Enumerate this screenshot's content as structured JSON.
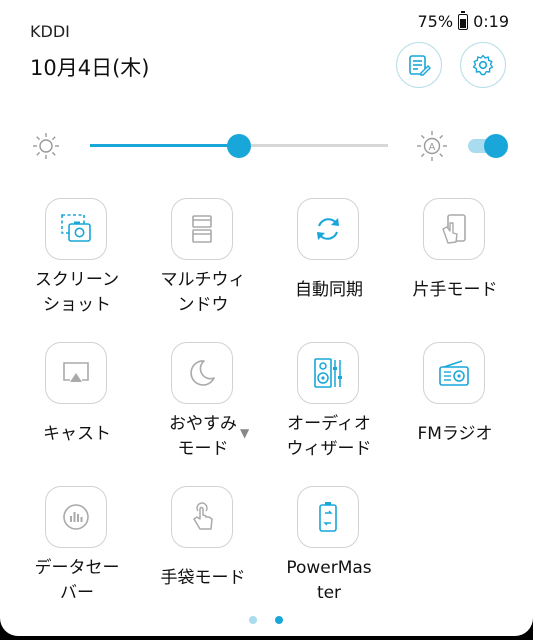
{
  "status_bar": {
    "carrier": "KDDI",
    "battery": "75%",
    "battery_level": 0.75,
    "time": "0:19"
  },
  "header": {
    "date": "10月4日(木)"
  },
  "brightness": {
    "level": 0.5,
    "auto": true
  },
  "tiles": [
    {
      "label": "スクリーン\nショット",
      "icon": "screenshot-icon",
      "active": true
    },
    {
      "label": "マルチウィ\nンドウ",
      "icon": "multi-window-icon",
      "active": false
    },
    {
      "label": "自動同期",
      "icon": "sync-icon",
      "active": true
    },
    {
      "label": "片手モード",
      "icon": "one-hand-icon",
      "active": false
    },
    {
      "label": "キャスト",
      "icon": "cast-icon",
      "active": false
    },
    {
      "label": "おやすみ\nモード",
      "icon": "moon-icon",
      "active": false
    },
    {
      "label": "オーディオ\nウィザード",
      "icon": "speaker-icon",
      "active": true
    },
    {
      "label": "FMラジオ",
      "icon": "radio-icon",
      "active": true
    },
    {
      "label": "データセー\nバー",
      "icon": "data-saver-icon",
      "active": false
    },
    {
      "label": "手袋モード",
      "icon": "glove-icon",
      "active": false
    },
    {
      "label": "PowerMas\nter",
      "icon": "battery-icon",
      "active": true
    }
  ],
  "pager": {
    "pages": 2,
    "current": 2
  },
  "colors": {
    "accent": "#19a7d9",
    "inactive": "#aaaaaa",
    "background": "#ffffff"
  }
}
